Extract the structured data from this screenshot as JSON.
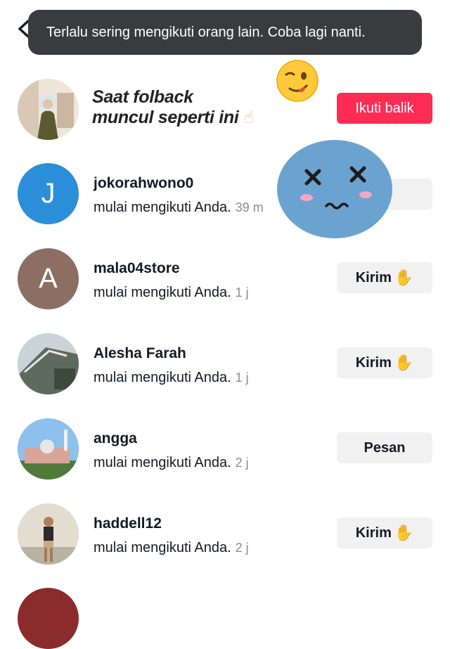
{
  "toast": {
    "text": "Terlalu sering mengikuti orang lain. Coba lagi nanti."
  },
  "overlay": {
    "caption_line1": "Saat folback",
    "caption_line2": "muncul seperti ini",
    "caption_emoji": "☝"
  },
  "top_item": {
    "button_label": "Ikuti balik"
  },
  "items": [
    {
      "name": "jokorahwono0",
      "subtitle": "mulai mengikuti Anda.",
      "time": "39 m",
      "avatar_letter": "J",
      "avatar_color": "#2a8fd8",
      "button_label": ""
    },
    {
      "name": "mala04store",
      "subtitle": "mulai mengikuti Anda.",
      "time": "1 j",
      "avatar_letter": "A",
      "avatar_color": "#8d6e63",
      "button_label": "Kirim"
    },
    {
      "name": "Alesha Farah",
      "subtitle": "mulai mengikuti Anda.",
      "time": "1 j",
      "button_label": "Kirim"
    },
    {
      "name": "angga",
      "subtitle": "mulai mengikuti Anda.",
      "time": "2 j",
      "button_label": "Pesan"
    },
    {
      "name": "haddell12",
      "subtitle": "mulai mengikuti Anda.",
      "time": "2 j",
      "button_label": "Kirim"
    }
  ],
  "icons": {
    "back": "chevron-left-icon",
    "wave": "waving-hand-emoji",
    "stickers": [
      "wink-face-sticker",
      "dizzy-blue-face-sticker"
    ]
  },
  "colors": {
    "primary_button": "#fe2c55",
    "secondary_button": "#f1f1f2",
    "toast_background": "#3a3b3f"
  }
}
